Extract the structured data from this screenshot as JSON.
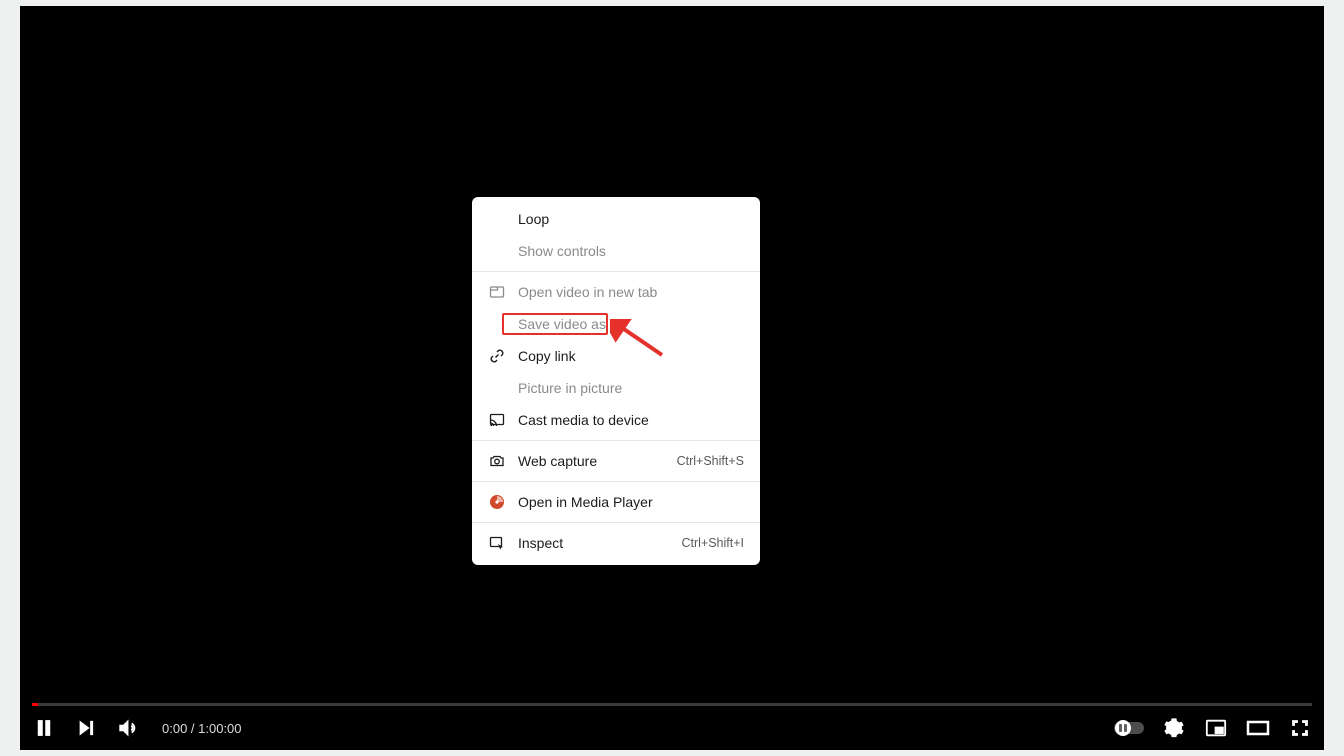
{
  "player": {
    "time": "0:00 / 1:00:00"
  },
  "context_menu": {
    "items": [
      {
        "label": "Loop",
        "disabled": false,
        "icon": ""
      },
      {
        "label": "Show controls",
        "disabled": true,
        "icon": ""
      },
      {
        "label": "Open video in new tab",
        "disabled": true,
        "icon": "tab"
      },
      {
        "label": "Save video as",
        "disabled": true,
        "icon": ""
      },
      {
        "label": "Copy link",
        "disabled": false,
        "icon": "link"
      },
      {
        "label": "Picture in picture",
        "disabled": true,
        "icon": ""
      },
      {
        "label": "Cast media to device",
        "disabled": false,
        "icon": "cast"
      },
      {
        "label": "Web capture",
        "disabled": false,
        "icon": "camera",
        "shortcut": "Ctrl+Shift+S"
      },
      {
        "label": "Open in Media Player",
        "disabled": false,
        "icon": "media"
      },
      {
        "label": "Inspect",
        "disabled": false,
        "icon": "inspect",
        "shortcut": "Ctrl+Shift+I"
      }
    ]
  }
}
